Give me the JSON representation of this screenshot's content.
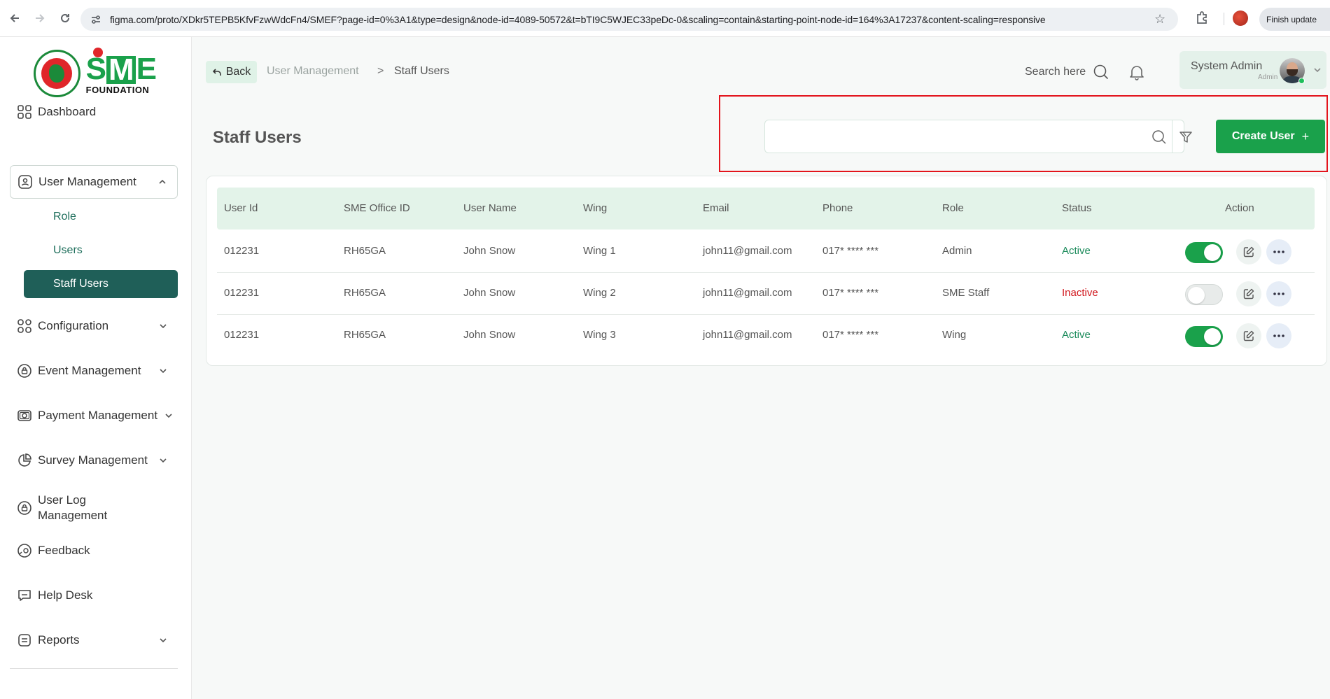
{
  "browser": {
    "url": "figma.com/proto/XDkr5TEPB5KfvFzwWdcFn4/SMEF?page-id=0%3A1&type=design&node-id=4089-50572&t=bTI9C5WJEC33peDc-0&scaling=contain&starting-point-node-id=164%3A17237&content-scaling=responsive",
    "finish_update": "Finish update"
  },
  "logo": {
    "brand": "SME",
    "sub": "FOUNDATION"
  },
  "sidebar": {
    "items": [
      {
        "label": "Dashboard"
      },
      {
        "label": "User Management"
      },
      {
        "label": "Configuration"
      },
      {
        "label": "Event Management"
      },
      {
        "label": "Payment Management"
      },
      {
        "label": "Survey Management"
      },
      {
        "label": "User Log Management"
      },
      {
        "label": "Feedback"
      },
      {
        "label": "Help Desk"
      },
      {
        "label": "Reports"
      }
    ],
    "submenu": [
      {
        "label": "Role"
      },
      {
        "label": "Users"
      },
      {
        "label": "Staff Users"
      }
    ]
  },
  "topbar": {
    "back_label": "Back",
    "breadcrumb_parent": "User Management",
    "breadcrumb_sep": ">",
    "breadcrumb_current": "Staff Users",
    "search_label": "Search here",
    "user_name": "System Admin",
    "user_role": "Admin"
  },
  "page": {
    "title": "Staff Users",
    "search_placeholder": "",
    "create_label": "Create User",
    "create_icon": "+"
  },
  "table": {
    "headers": [
      "User Id",
      "SME Office ID",
      "User Name",
      "Wing",
      "Email",
      "Phone",
      "Role",
      "Status",
      "Action"
    ],
    "rows": [
      {
        "user_id": "012231",
        "office_id": "RH65GA",
        "name": "John Snow",
        "wing": "Wing 1",
        "email": "john11@gmail.com",
        "phone": "017* **** ***",
        "role": "Admin",
        "status": "Active",
        "enabled": true
      },
      {
        "user_id": "012231",
        "office_id": "RH65GA",
        "name": "John Snow",
        "wing": "Wing 2",
        "email": "john11@gmail.com",
        "phone": "017* **** ***",
        "role": "SME Staff",
        "status": "Inactive",
        "enabled": false
      },
      {
        "user_id": "012231",
        "office_id": "RH65GA",
        "name": "John Snow",
        "wing": "Wing 3",
        "email": "john11@gmail.com",
        "phone": "017* **** ***",
        "role": "Wing",
        "status": "Active",
        "enabled": true
      }
    ]
  },
  "colors": {
    "primary_green": "#1aa14b",
    "active_submenu": "#1f5f58",
    "inactive_red": "#d1171d",
    "highlight_red": "#e3141c"
  }
}
